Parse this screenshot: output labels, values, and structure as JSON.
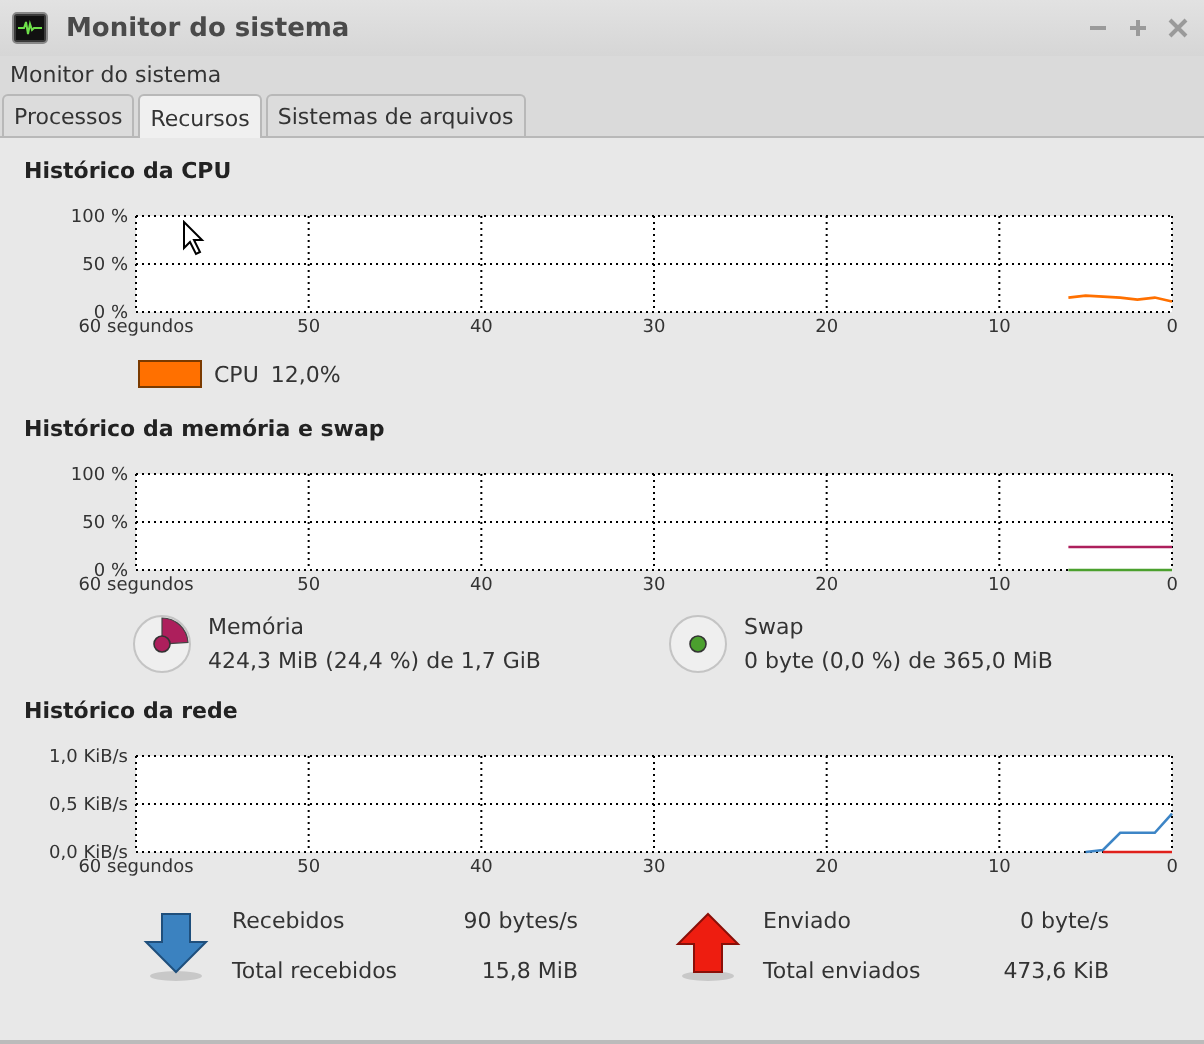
{
  "window": {
    "title": "Monitor do sistema"
  },
  "menu_label": "Monitor do sistema",
  "tabs": [
    {
      "label": "Processos",
      "selected": false
    },
    {
      "label": "Recursos",
      "selected": true
    },
    {
      "label": "Sistemas de arquivos",
      "selected": false
    }
  ],
  "cpu": {
    "title": "Histórico da CPU",
    "chart_data": {
      "type": "line",
      "grid": true,
      "x": [
        6,
        5,
        4,
        3,
        2,
        1,
        0
      ],
      "xlim": [
        60,
        0
      ],
      "ylim": [
        0,
        100
      ],
      "xticks": [
        {
          "value": 60,
          "label": "60 segundos"
        },
        50,
        40,
        30,
        20,
        10,
        0
      ],
      "yticks": [
        {
          "value": 100,
          "label": "100 %"
        },
        {
          "value": 50,
          "label": "50 %"
        },
        {
          "value": 0,
          "label": "0 %"
        }
      ],
      "series": [
        {
          "name": "CPU",
          "color": "#ff7000",
          "values": [
            15,
            17,
            16,
            15,
            13,
            15,
            11
          ]
        }
      ]
    },
    "reading": "12,0%"
  },
  "memory": {
    "title": "Histórico da memória e swap",
    "chart_data": {
      "type": "line",
      "grid": true,
      "x": [
        6,
        0
      ],
      "xlim": [
        60,
        0
      ],
      "ylim": [
        0,
        100
      ],
      "xticks": [
        {
          "value": 60,
          "label": "60 segundos"
        },
        50,
        40,
        30,
        20,
        10,
        0
      ],
      "yticks": [
        {
          "value": 100,
          "label": "100 %"
        },
        {
          "value": 50,
          "label": "50 %"
        },
        {
          "value": 0,
          "label": "0 %"
        }
      ],
      "series": [
        {
          "name": "Memória",
          "color": "#ad1f5c",
          "values": [
            24,
            24
          ]
        },
        {
          "name": "Swap",
          "color": "#4ba02e",
          "values": [
            0,
            0
          ]
        }
      ]
    },
    "items": [
      {
        "detail": "424,3 MiB (24,4 %) de 1,7 GiB"
      },
      {
        "detail": "0 byte (0,0 %) de 365,0 MiB"
      }
    ]
  },
  "network": {
    "title": "Histórico da rede",
    "chart_data": {
      "type": "line",
      "grid": true,
      "x": [
        5,
        4,
        3,
        2,
        1,
        0
      ],
      "xlim": [
        60,
        0
      ],
      "ylim": [
        0,
        1
      ],
      "xticks": [
        {
          "value": 60,
          "label": "60 segundos"
        },
        50,
        40,
        30,
        20,
        10,
        0
      ],
      "yticks": [
        {
          "value": 1,
          "label": "1,0 KiB/s"
        },
        {
          "value": 0.5,
          "label": "0,5 KiB/s"
        },
        {
          "value": 0,
          "label": "0,0 KiB/s"
        }
      ],
      "series": [
        {
          "name": "Recebidos",
          "color": "#3d85c6",
          "values": [
            0,
            0.02,
            0.2,
            0.2,
            0.2,
            0.4
          ]
        },
        {
          "name": "Enviado",
          "color": "#e0201b",
          "values": [
            null,
            0,
            0,
            0,
            0,
            0
          ]
        }
      ]
    },
    "stats": [
      {
        "kind": "received",
        "rate": "90 bytes/s",
        "total_label": "Total recebidos",
        "total": "15,8 MiB"
      },
      {
        "kind": "sent",
        "rate": "0 byte/s",
        "total_label": "Total enviados",
        "total": "473,6 KiB"
      }
    ]
  }
}
